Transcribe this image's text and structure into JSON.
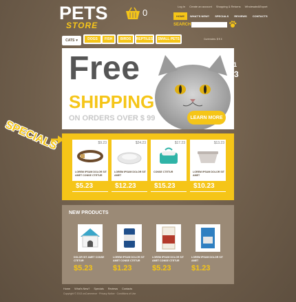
{
  "header": {
    "logo_main": "PETS",
    "logo_sub": "STORE",
    "cart_count": "0",
    "top_links": [
      "Log In",
      "Create an account",
      "Shopping & Returns",
      "Wholesale&Export"
    ],
    "nav": [
      "HOME",
      "WHAT'S NEW?",
      "SPECIALS",
      "REVIEWS",
      "CONTACTS"
    ],
    "search_label": "SEARCH",
    "search_placeholder": "",
    "cart_icon": "basket-icon"
  },
  "categories": {
    "cats_label": "CATS",
    "items": [
      "DOGS",
      "FISH",
      "BIRDS",
      "REPTILES",
      "SMALL PETS"
    ],
    "right_text": "Currencies: $ € £"
  },
  "banner": {
    "line1": "Free",
    "line2": "SHIPPING",
    "line3": "ON ORDERS OVER $ 99",
    "button": "LEARN MORE",
    "slides": [
      "1",
      "2",
      "3"
    ]
  },
  "specials": {
    "label": "SPECIALS",
    "products": [
      {
        "old_price": "$9.23",
        "desc": "LOREM IPSUM DOLOR SIT AMET CONSE CTETUR",
        "price": "$5.23",
        "icon": "dog-collar-icon"
      },
      {
        "old_price": "$24.23",
        "desc": "LOREM IPSUM DOLOR SIT AMET",
        "price": "$12.23",
        "icon": "pet-bed-icon"
      },
      {
        "old_price": "$17.23",
        "desc": "CONSE CTETUR",
        "price": "$15.23",
        "icon": "pet-carrier-icon"
      },
      {
        "old_price": "$13.23",
        "desc": "LOREM IPSUM DOLOR SIT AMET",
        "price": "$10.23",
        "icon": "litter-box-icon"
      }
    ]
  },
  "new_products": {
    "title": "NEW PRODUCTS",
    "products": [
      {
        "desc": "DOLOR SIT AMET CONSE CTETUR",
        "price": "$5.23",
        "icon": "dog-house-icon"
      },
      {
        "desc": "LOREM IPSUM DOLOR SIT AMET CONSE CTETUR",
        "price": "$1.23",
        "icon": "pet-food-can-icon"
      },
      {
        "desc": "LOREM IPSUM DOLOR SIT AMET CONSE CTETUR",
        "price": "$5.23",
        "icon": "pet-food-bag-icon"
      },
      {
        "desc": "LOREM IPSUM DOLOR SIT AMET",
        "price": "$1.23",
        "icon": "treat-pack-icon"
      }
    ]
  },
  "footer": {
    "links": [
      "Home",
      "What's New?",
      "Specials",
      "Reviews",
      "Contacts"
    ],
    "copyright": "Copyright © 2013 osCommerce · Privacy Notice · Conditions of Use"
  },
  "colors": {
    "accent": "#f5c518",
    "background": "#75634f",
    "panel": "#9b8a76"
  }
}
